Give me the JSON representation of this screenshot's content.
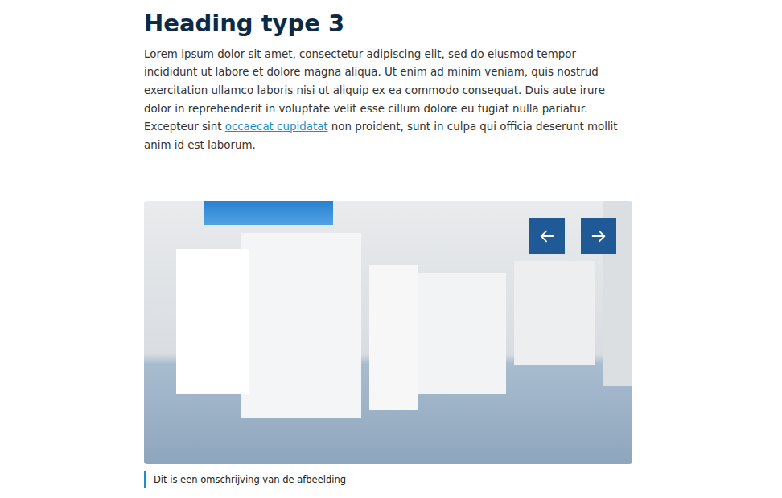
{
  "heading": "Heading type 3",
  "paragraph": {
    "before": "Lorem ipsum dolor sit amet, consectetur adipiscing elit, sed do eiusmod tempor incididunt ut labore et dolore magna aliqua. Ut enim ad minim veniam, quis nostrud exercitation ullamco laboris nisi ut aliquip ex ea commodo consequat. Duis aute irure dolor in reprehenderit in voluptate velit esse cillum dolore eu fugiat nulla pariatur. Excepteur sint ",
    "link": "occaecat cupidatat",
    "after": " non proident, sunt in culpa qui officia deserunt mollit anim id est laborum."
  },
  "carousel": {
    "caption": "Dit is een omschrijving van de afbeelding"
  }
}
